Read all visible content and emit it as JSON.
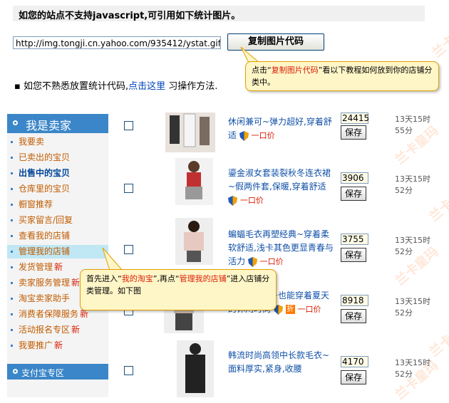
{
  "header": {
    "title": "如您的站点不支持javascript,可引用如下统计图片。"
  },
  "code_url": "http://img.tongji.cn.yahoo.com/935412/ystat.gif",
  "copy_button": "复制图片代码",
  "tip1": {
    "prefix": "点击“",
    "highlight": "复制图片代码",
    "suffix": "”看以下教程如何放到你的店铺分类中。"
  },
  "info": {
    "prefix": "▪ 如您不熟悉放置统计代码,",
    "link": "点击这里",
    "suffix": " 习操作方法."
  },
  "sidebar": {
    "title": "我是卖家",
    "items": [
      {
        "label": "我要卖",
        "new": ""
      },
      {
        "label": "已卖出的宝贝",
        "new": ""
      },
      {
        "label": "出售中的宝贝",
        "new": ""
      },
      {
        "label": "仓库里的宝贝",
        "new": ""
      },
      {
        "label": "橱窗推荐",
        "new": ""
      },
      {
        "label": "买家留言/回复",
        "new": ""
      },
      {
        "label": "查看我的店铺",
        "new": ""
      },
      {
        "label": "管理我的店铺",
        "new": ""
      },
      {
        "label": "发货管理",
        "new": "新"
      },
      {
        "label": "卖家服务管理",
        "new": "新"
      },
      {
        "label": "淘宝卖家助手",
        "new": ""
      },
      {
        "label": "消费者保障服务",
        "new": "新"
      },
      {
        "label": "活动报名专区",
        "new": "新"
      },
      {
        "label": "我要推广",
        "new": "新"
      }
    ],
    "footer": "支付宝专区"
  },
  "tip2": {
    "p1": "首先进入“",
    "h1": "我的淘宝",
    "p2": "”,再点“",
    "h2": "管理我的店铺",
    "p3": "”进入店铺分类管理。如下图"
  },
  "products": [
    {
      "title": "休闲兼可~弹力超好,穿着舒适",
      "price": "一口价",
      "qty": "24415",
      "save": "保存",
      "time": "13天15时55分"
    },
    {
      "title": "鎏金淑女套装裂秋冬连衣裙~假两件套,保暖,穿着舒适",
      "price": "一口价",
      "qty": "3906",
      "save": "保存",
      "time": "13天15时52分"
    },
    {
      "title": "蝙蝠毛衣再塑经典~穿着柔软舒适,浅卡其色更显青春与活力",
      "price": "一口价",
      "qty": "3755",
      "save": "保存",
      "time": "13天15时52分"
    },
    {
      "title": "配保暖内衫~也能穿着夏天的休闲时尚",
      "price": "一口价",
      "qty": "8918",
      "save": "保存",
      "time": "13天15时52分"
    },
    {
      "title": "韩流时尚高领中长款毛衣~面料厚实,紧身,收腰",
      "price": "",
      "qty": "4170",
      "save": "保存",
      "time": "13天15时52分"
    }
  ],
  "watermark": "兰卡皇玛"
}
